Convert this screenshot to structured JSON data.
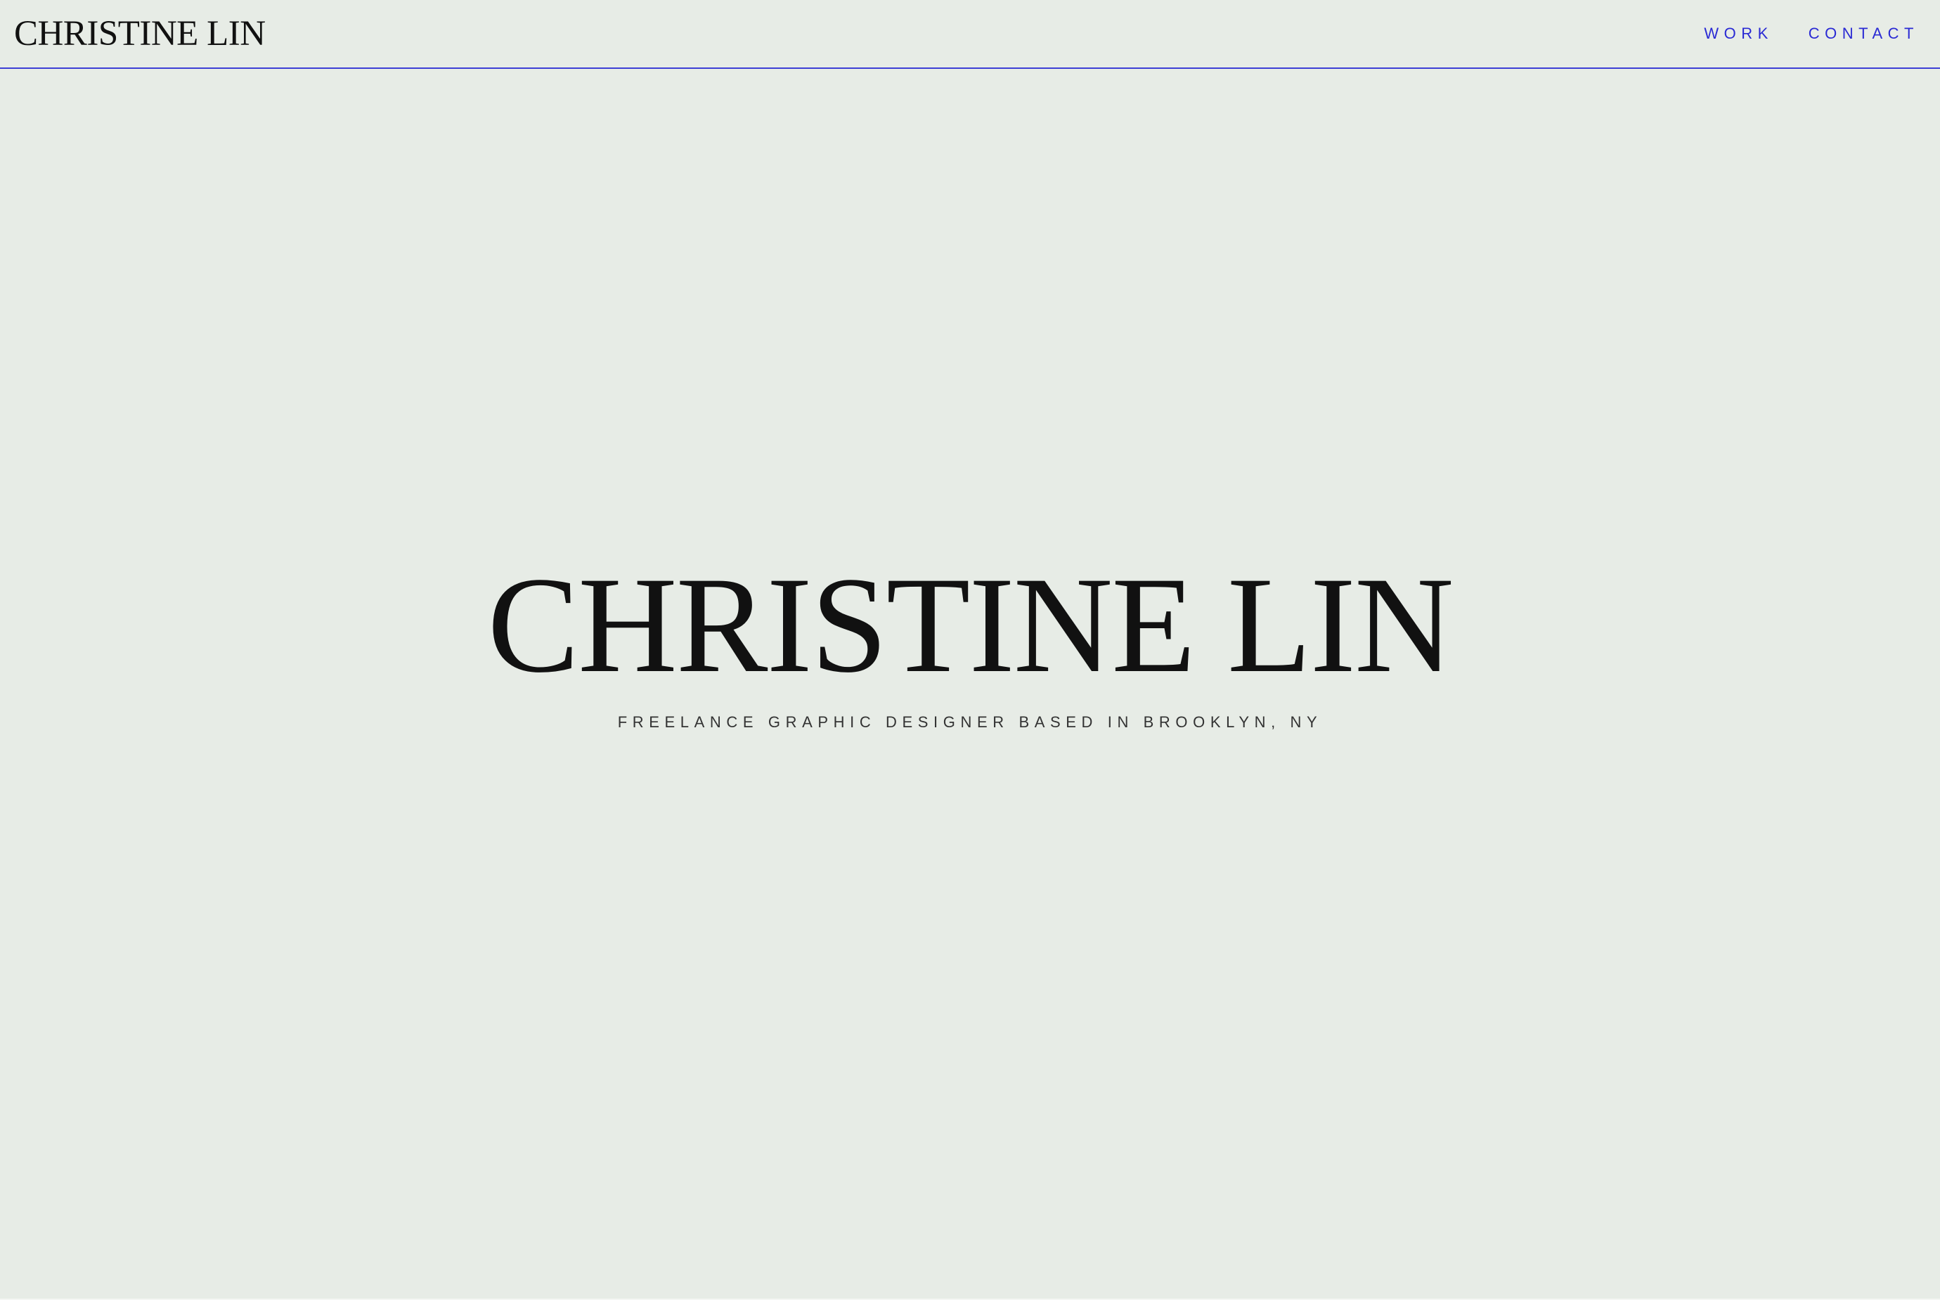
{
  "header": {
    "logo_text": "CHRISTINE LIN",
    "nav": [
      {
        "label": "WORK"
      },
      {
        "label": "CONTACT"
      }
    ]
  },
  "hero": {
    "title": "CHRISTINE LIN",
    "subtitle": "FREELANCE GRAPHIC DESIGNER BASED IN BROOKLYN, NY"
  },
  "colors": {
    "background": "#e7ece6",
    "accent": "#2a2ad4",
    "text": "#111111"
  }
}
